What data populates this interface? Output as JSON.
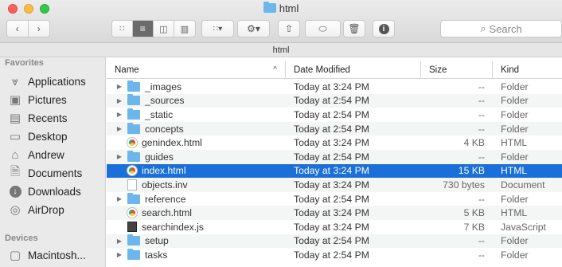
{
  "window": {
    "title": "html"
  },
  "toolbar": {
    "search_placeholder": "Search"
  },
  "pathbar": {
    "label": "html"
  },
  "sidebar": {
    "favorites_label": "Favorites",
    "favorites": [
      {
        "label": "Applications",
        "icon": "applications-icon"
      },
      {
        "label": "Pictures",
        "icon": "camera-icon"
      },
      {
        "label": "Recents",
        "icon": "recents-icon"
      },
      {
        "label": "Desktop",
        "icon": "desktop-icon"
      },
      {
        "label": "Andrew",
        "icon": "home-icon"
      },
      {
        "label": "Documents",
        "icon": "documents-icon"
      },
      {
        "label": "Downloads",
        "icon": "downloads-icon"
      },
      {
        "label": "AirDrop",
        "icon": "airdrop-icon"
      }
    ],
    "devices_label": "Devices",
    "devices": [
      {
        "label": "Macintosh...",
        "icon": "disk-icon"
      }
    ]
  },
  "table": {
    "columns": {
      "name": "Name",
      "date": "Date Modified",
      "size": "Size",
      "kind": "Kind",
      "sort_indicator": "^"
    },
    "rows": [
      {
        "name": "_images",
        "date": "Today at 3:24 PM",
        "size": "--",
        "kind": "Folder",
        "type": "folder",
        "expandable": true,
        "selected": false
      },
      {
        "name": "_sources",
        "date": "Today at 2:54 PM",
        "size": "--",
        "kind": "Folder",
        "type": "folder",
        "expandable": true,
        "selected": false
      },
      {
        "name": "_static",
        "date": "Today at 2:54 PM",
        "size": "--",
        "kind": "Folder",
        "type": "folder",
        "expandable": true,
        "selected": false
      },
      {
        "name": "concepts",
        "date": "Today at 2:54 PM",
        "size": "--",
        "kind": "Folder",
        "type": "folder",
        "expandable": true,
        "selected": false
      },
      {
        "name": "genindex.html",
        "date": "Today at 3:24 PM",
        "size": "4 KB",
        "kind": "HTML",
        "type": "html",
        "expandable": false,
        "selected": false
      },
      {
        "name": "guides",
        "date": "Today at 2:54 PM",
        "size": "--",
        "kind": "Folder",
        "type": "folder",
        "expandable": true,
        "selected": false
      },
      {
        "name": "index.html",
        "date": "Today at 3:24 PM",
        "size": "15 KB",
        "kind": "HTML",
        "type": "html",
        "expandable": false,
        "selected": true
      },
      {
        "name": "objects.inv",
        "date": "Today at 3:24 PM",
        "size": "730 bytes",
        "kind": "Document",
        "type": "doc",
        "expandable": false,
        "selected": false
      },
      {
        "name": "reference",
        "date": "Today at 2:54 PM",
        "size": "--",
        "kind": "Folder",
        "type": "folder",
        "expandable": true,
        "selected": false
      },
      {
        "name": "search.html",
        "date": "Today at 3:24 PM",
        "size": "5 KB",
        "kind": "HTML",
        "type": "html",
        "expandable": false,
        "selected": false
      },
      {
        "name": "searchindex.js",
        "date": "Today at 3:24 PM",
        "size": "7 KB",
        "kind": "JavaScript",
        "type": "js",
        "expandable": false,
        "selected": false
      },
      {
        "name": "setup",
        "date": "Today at 2:54 PM",
        "size": "--",
        "kind": "Folder",
        "type": "folder",
        "expandable": true,
        "selected": false
      },
      {
        "name": "tasks",
        "date": "Today at 2:54 PM",
        "size": "--",
        "kind": "Folder",
        "type": "folder",
        "expandable": true,
        "selected": false
      }
    ]
  },
  "colors": {
    "selection": "#1a6fd8",
    "folder": "#6cb6ec",
    "close": "#fc605b",
    "minimize": "#fdbc40",
    "zoom": "#34c84a"
  }
}
